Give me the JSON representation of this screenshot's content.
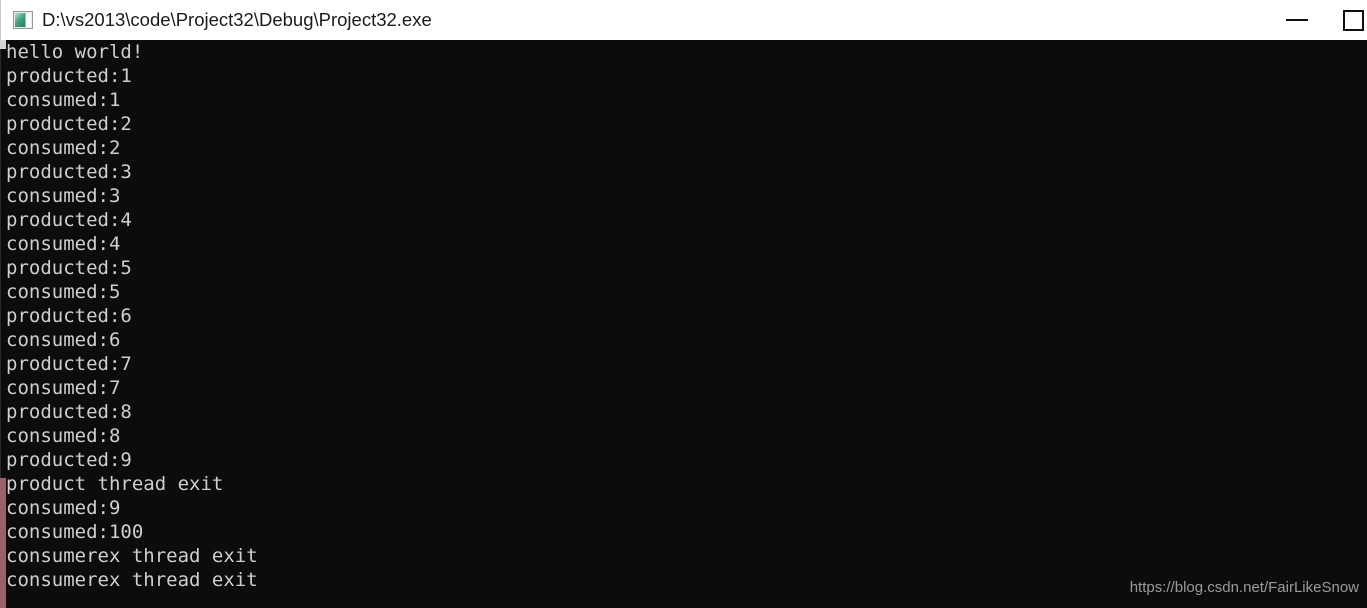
{
  "window": {
    "title": "D:\\vs2013\\code\\Project32\\Debug\\Project32.exe",
    "icon_name": "console-app-icon",
    "background_color": "#0c0c0c",
    "titlebar_color": "#ffffff",
    "text_color": "#cfcfcf"
  },
  "controls": {
    "minimize_label": "—",
    "minimize_name": "minimize-button",
    "maximize_label": "☐",
    "maximize_name": "maximize-button"
  },
  "console": {
    "lines": [
      "hello world!",
      "producted:1",
      "consumed:1",
      "producted:2",
      "consumed:2",
      "producted:3",
      "consumed:3",
      "producted:4",
      "consumed:4",
      "producted:5",
      "consumed:5",
      "producted:6",
      "consumed:6",
      "producted:7",
      "consumed:7",
      "producted:8",
      "consumed:8",
      "producted:9",
      "product thread exit",
      "consumed:9",
      "consumed:100",
      "consumerex thread exit",
      "consumerex thread exit"
    ]
  },
  "scrollbar": {
    "thumb_color": "#9c5f6b",
    "track_color": "#0c0c0c",
    "cap_color": "#d4d4d4"
  },
  "watermark": {
    "text": "https://blog.csdn.net/FairLikeSnow",
    "color": "#9a9a9a"
  }
}
